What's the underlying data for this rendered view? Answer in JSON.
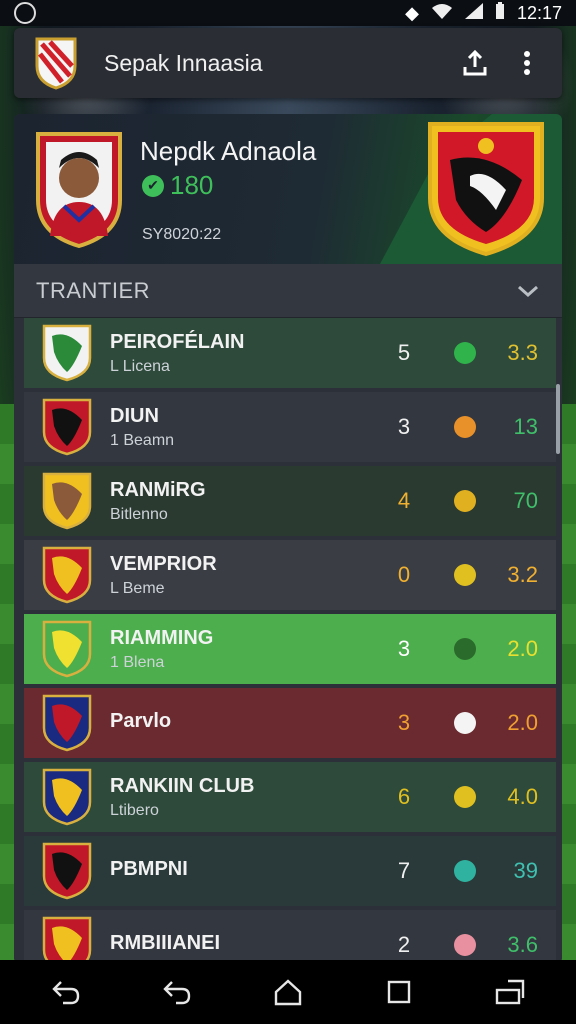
{
  "status_bar": {
    "time": "12:17",
    "icons": [
      "location-icon",
      "wifi-icon",
      "signal-icon",
      "battery-icon"
    ]
  },
  "app_bar": {
    "title": "Sepak Innaasia",
    "actions": [
      "share-icon",
      "more-vert-icon"
    ]
  },
  "hero": {
    "player_name": "Nepdk Adnaola",
    "score": "180",
    "date": "SY8020:22"
  },
  "section": {
    "title": "TRANTIER"
  },
  "rows": [
    {
      "team": "PEIROFÉLAIN",
      "sub": "L Licena",
      "number": "5",
      "rating": "3.3",
      "bg": "#2d4a3a",
      "num_color": "#f0f0f0",
      "rating_color": "#e0c030",
      "ball_color": "#2fb34a"
    },
    {
      "team": "DIUN",
      "sub": "1 Beamn",
      "number": "3",
      "rating": "13",
      "bg": "#33373f",
      "num_color": "#f0f0f0",
      "rating_color": "#3fbf6a",
      "ball_color": "#e8902a"
    },
    {
      "team": "RANMiRG",
      "sub": "Bitlenno",
      "number": "4",
      "rating": "70",
      "bg": "#2a3a30",
      "num_color": "#f0b030",
      "rating_color": "#3fbf6a",
      "ball_color": "#e0b020"
    },
    {
      "team": "VEMPRIOR",
      "sub": "L Beme",
      "number": "0",
      "rating": "3.2",
      "bg": "#3a3d44",
      "num_color": "#f0b030",
      "rating_color": "#f0b030",
      "ball_color": "#e0c020"
    },
    {
      "team": "RIAMMING",
      "sub": "1 Blena",
      "number": "3",
      "rating": "2.0",
      "bg": "#4cae4c",
      "num_color": "#ffffff",
      "rating_color": "#e8e030",
      "ball_color": "#2a6a2a"
    },
    {
      "team": "Parvlo",
      "sub": "",
      "number": "3",
      "rating": "2.0",
      "bg": "#6a2a30",
      "num_color": "#f0a030",
      "rating_color": "#f0a030",
      "ball_color": "#f4f4f4"
    },
    {
      "team": "RANKIIN CLUB",
      "sub": "Ltibero",
      "number": "6",
      "rating": "4.0",
      "bg": "#2d4a3a",
      "num_color": "#e0c020",
      "rating_color": "#e0c020",
      "ball_color": "#e0c020"
    },
    {
      "team": "PBMPNI",
      "sub": "",
      "number": "7",
      "rating": "39",
      "bg": "#2a3a3a",
      "num_color": "#f0f0f0",
      "rating_color": "#3fc0b0",
      "ball_color": "#2fb3a0"
    },
    {
      "team": "RMBIIIANEI",
      "sub": "",
      "number": "2",
      "rating": "3.6",
      "bg": "#33373f",
      "num_color": "#f0f0f0",
      "rating_color": "#3fbf6a",
      "ball_color": "#e890a0"
    }
  ],
  "nav": [
    "back-icon",
    "undo-icon",
    "home-icon",
    "recents-icon",
    "rotate-icon"
  ]
}
